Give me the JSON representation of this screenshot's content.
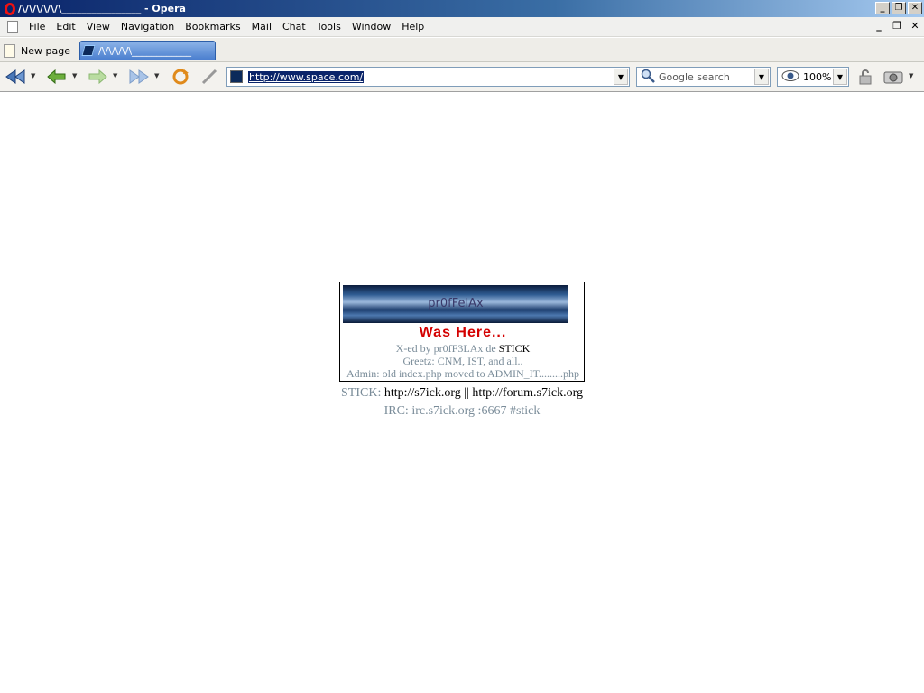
{
  "window": {
    "title": "/\\/\\/\\/\\/\\/\\________________ - Opera",
    "controls": [
      "_",
      "❐",
      "✕"
    ]
  },
  "menu": {
    "items": [
      "File",
      "Edit",
      "View",
      "Navigation",
      "Bookmarks",
      "Mail",
      "Chat",
      "Tools",
      "Window",
      "Help"
    ],
    "mdi_controls": [
      "_",
      "❐",
      "✕"
    ]
  },
  "tabs": {
    "new_page_label": "New page",
    "active_tab_label": "/\\/\\/\\/\\/\\____________"
  },
  "toolbar": {
    "address_value": "http://www.space.com/",
    "search_placeholder": "Google search",
    "zoom_value": "100%"
  },
  "page": {
    "banner_text": "pr0fFelAx",
    "was_here": "Was Here...",
    "xed_prefix": "X-ed by pr0fF3LAx de ",
    "xed_stick": "STICK",
    "greetz": "Greetz: CNM, IST, and all..",
    "admin_note": "Admin: old index.php moved to ADMIN_IT.........php",
    "stick_prefix": "STICK: ",
    "stick_link1": "http://s7ick.org",
    "stick_sep": " || ",
    "stick_link2": "http://forum.s7ick.org",
    "irc": "IRC: irc.s7ick.org :6667 #stick"
  },
  "colors": {
    "titlebar_start": "#0a246a",
    "tab_active": "#4b7fcf",
    "was_here_red": "#d40000",
    "muted_text": "#7a8c99"
  }
}
